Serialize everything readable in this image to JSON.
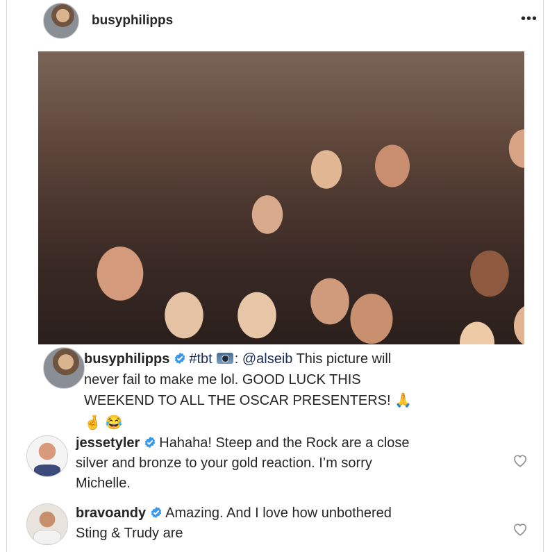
{
  "post": {
    "username": "busyphilipps",
    "more_icon": "more-horizontal-icon",
    "photo_icon": "photo"
  },
  "caption": {
    "username": "busyphilipps",
    "hashtag": "#tbt",
    "camera_emoji": "camera-icon",
    "mention_prefix": ": ",
    "mention": "@alseib",
    "text_line1": " This picture will",
    "text_line2": "never fail to make me lol. GOOD LUCK THIS",
    "text_line3": "WEEKEND TO ALL THE OSCAR PRESENTERS! ",
    "emoji_pray": "🙏",
    "emoji_hand": "🤞",
    "emoji_laugh": "😂"
  },
  "comments": [
    {
      "username": "jessetyler",
      "text_line1": "Hahaha! Steep and the Rock are a close",
      "text_line2": "silver and bronze to your gold reaction. I’m sorry",
      "text_line3": "Michelle."
    },
    {
      "username": "bravoandy",
      "text_line1": "Amazing.  And I love how unbothered",
      "text_line2": "Sting & Trudy are"
    }
  ],
  "colors": {
    "verified_blue": "#3897f0",
    "text": "#262626",
    "link": "#1a2b55",
    "heart_stroke": "#8e8e8e"
  }
}
